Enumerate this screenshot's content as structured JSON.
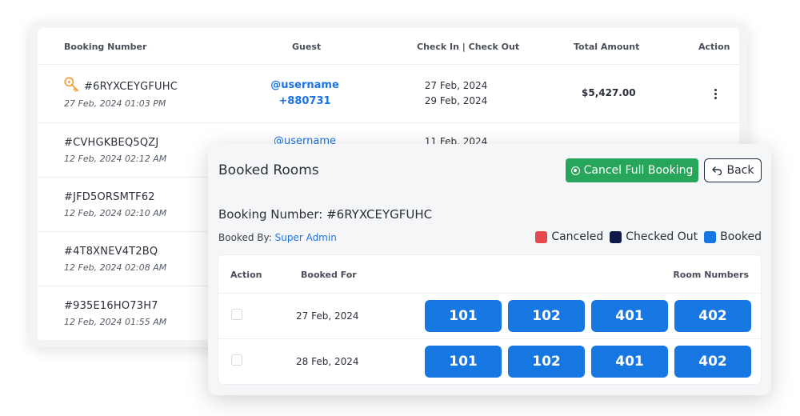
{
  "bookings_table": {
    "headers": {
      "booking_number": "Booking Number",
      "guest": "Guest",
      "check_in_out": "Check In | Check Out",
      "total_amount": "Total Amount",
      "action": "Action"
    },
    "rows": [
      {
        "number": "#6RYXCEYGFUHC",
        "date": "27 Feb, 2024 01:03 PM",
        "guest_user": "@username",
        "guest_phone": "+880731",
        "check_in": "27 Feb, 2024",
        "check_out": "29 Feb, 2024",
        "amount": "$5,427.00",
        "icon": "key-icon"
      },
      {
        "number": "#CVHGKBEQ5QZJ",
        "date": "12 Feb, 2024 02:12 AM",
        "guest_user": "@username",
        "check_in": "11 Feb, 2024"
      },
      {
        "number": "#JFD5ORSMTF62",
        "date": "12 Feb, 2024 02:10 AM"
      },
      {
        "number": "#4T8XNEV4T2BQ",
        "date": "12 Feb, 2024 02:08 AM"
      },
      {
        "number": "#935E16HO73H7",
        "date": "12 Feb, 2024 01:55 AM"
      }
    ]
  },
  "modal": {
    "title": "Booked Rooms",
    "cancel_button": "Cancel Full Booking",
    "back_button": "Back",
    "booking_number": "Booking Number: #6RYXCEYGFUHC",
    "booked_by_label": "Booked By:",
    "booked_by_name": "Super Admin",
    "legend": [
      {
        "label": "Canceled",
        "color": "#e5484d"
      },
      {
        "label": "Checked Out",
        "color": "#0f1a4a"
      },
      {
        "label": "Booked",
        "color": "#1677e3"
      }
    ],
    "table": {
      "headers": {
        "action": "Action",
        "booked_for": "Booked For",
        "room_numbers": "Room Numbers"
      },
      "rows": [
        {
          "date": "27 Feb, 2024",
          "rooms": [
            "101",
            "102",
            "401",
            "402"
          ]
        },
        {
          "date": "28 Feb, 2024",
          "rooms": [
            "101",
            "102",
            "401",
            "402"
          ]
        }
      ]
    }
  },
  "colors": {
    "accent_blue": "#1677e3",
    "success_green": "#27a55a",
    "key_orange": "#f4a340"
  }
}
